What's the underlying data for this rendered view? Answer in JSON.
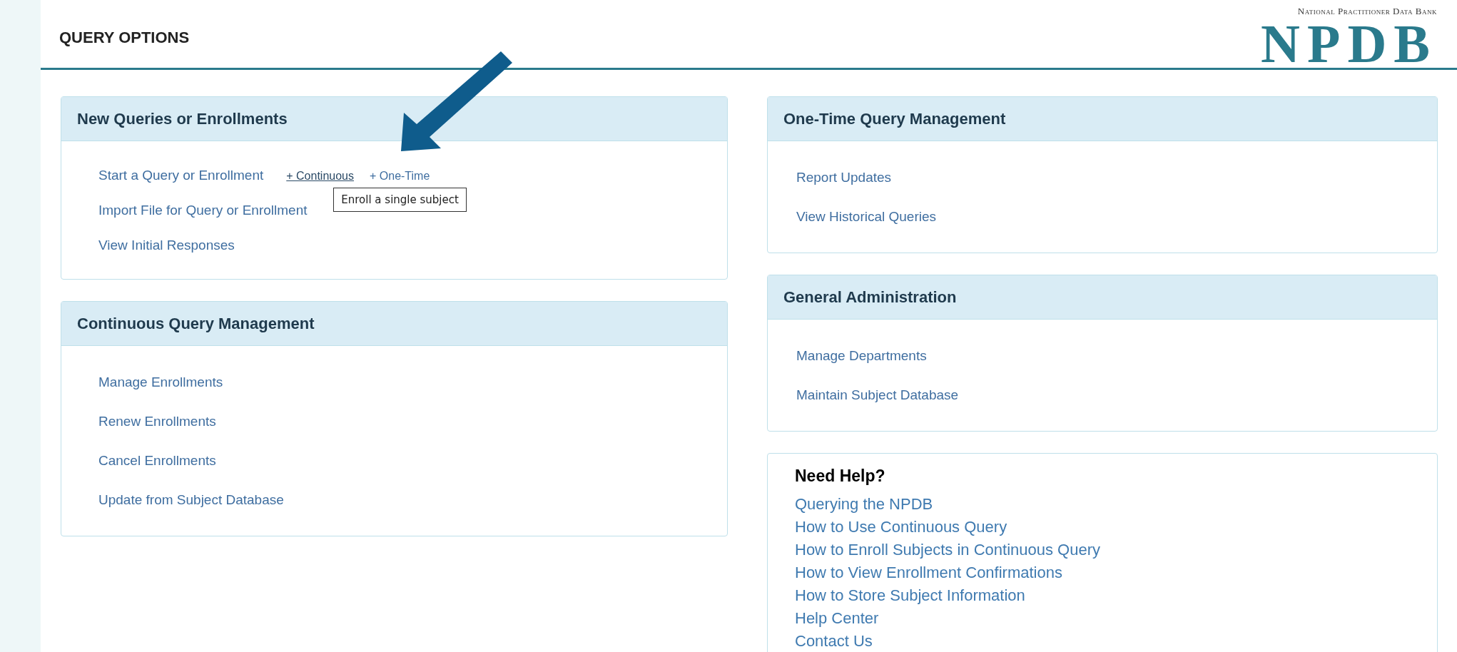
{
  "page_title": "QUERY OPTIONS",
  "logo": {
    "tagline": "National Practitioner Data Bank",
    "wordmark": "NPDB"
  },
  "left_panels": [
    {
      "title": "New Queries or Enrollments",
      "items": [
        {
          "label": "Start a Query or Enrollment",
          "actions": [
            {
              "label": "+ Continuous",
              "hovered": true,
              "tooltip": "Enroll a single subject"
            },
            {
              "label": "+ One-Time",
              "hovered": false
            }
          ]
        },
        {
          "label": "Import File for Query or Enrollment"
        },
        {
          "label": "View Initial Responses"
        }
      ]
    },
    {
      "title": "Continuous Query Management",
      "items": [
        {
          "label": "Manage Enrollments"
        },
        {
          "label": "Renew Enrollments"
        },
        {
          "label": "Cancel Enrollments"
        },
        {
          "label": "Update from Subject Database"
        }
      ]
    }
  ],
  "right_panels": [
    {
      "title": "One-Time Query Management",
      "items": [
        {
          "label": "Report Updates"
        },
        {
          "label": "View Historical Queries"
        }
      ]
    },
    {
      "title": "General Administration",
      "items": [
        {
          "label": "Manage Departments"
        },
        {
          "label": "Maintain Subject Database"
        }
      ]
    }
  ],
  "help": {
    "title": "Need Help?",
    "links": [
      "Querying the NPDB",
      "How to Use Continuous Query",
      "How to Enroll Subjects in Continuous Query",
      "How to View Enrollment Confirmations",
      "How to Store Subject Information",
      "Help Center",
      "Contact Us"
    ]
  }
}
